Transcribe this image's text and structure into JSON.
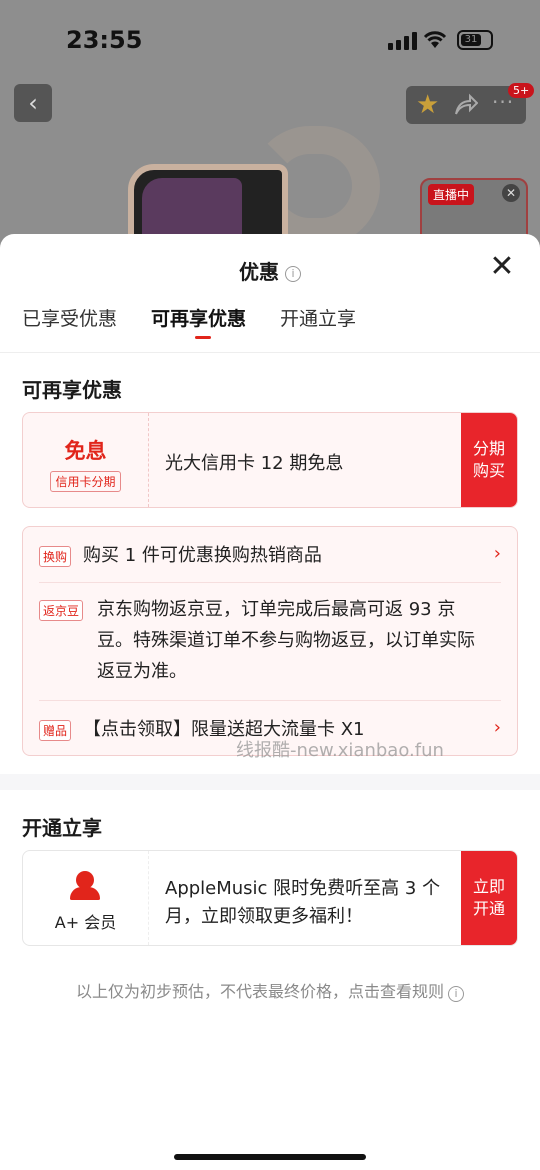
{
  "status_bar": {
    "time": "23:55",
    "battery": "31"
  },
  "product_page": {
    "cart_badge": "5+",
    "live_tag": "直播中"
  },
  "sheet": {
    "title": "优惠",
    "tabs": [
      {
        "label": "已享受优惠",
        "active": false
      },
      {
        "label": "可再享优惠",
        "active": true
      },
      {
        "label": "开通立享",
        "active": false
      }
    ],
    "reenjoy": {
      "section_title": "可再享优惠",
      "installment_card": {
        "left_title": "免息",
        "left_tag": "信用卡分期",
        "text": "光大信用卡 12 期免息",
        "button": "分期购买"
      },
      "promos": [
        {
          "tag": "换购",
          "text": "购买 1 件可优惠换购热销商品",
          "has_arrow": true
        },
        {
          "tag": "返京豆",
          "text": "京东购物返京豆，订单完成后最高可返 93 京豆。特殊渠道订单不参与购物返豆，以订单实际返豆为准。",
          "has_arrow": false
        },
        {
          "tag": "赠品",
          "text": "【点击领取】限量送超大流量卡 X1",
          "has_arrow": true
        }
      ]
    },
    "open_enjoy": {
      "section_title": "开通立享",
      "member_card": {
        "label": "A+ 会员",
        "text": "AppleMusic 限时免费听至高 3 个月，立即领取更多福利！",
        "button": "立即开通"
      }
    },
    "footnote": "以上仅为初步预估，不代表最终价格，点击查看规则"
  },
  "watermark": "线报酷-new.xianbao.fun",
  "colors": {
    "accent": "#e1251b",
    "button_red": "#e8252b",
    "card_bg": "#fff6f6"
  }
}
